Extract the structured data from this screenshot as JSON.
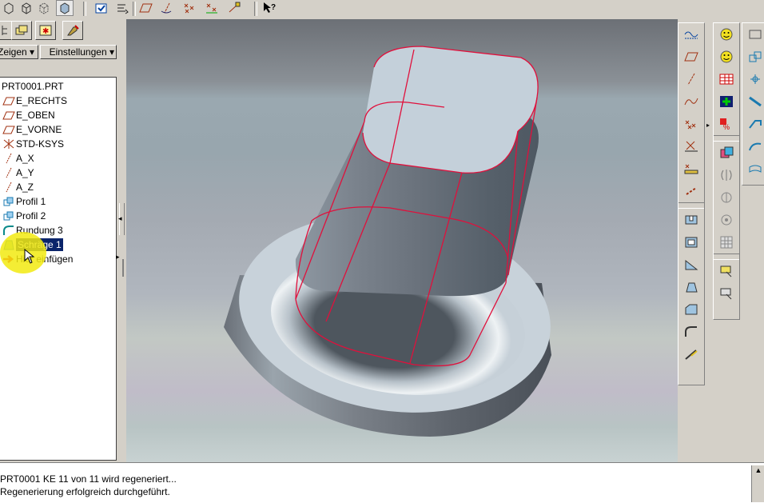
{
  "toolbar": {
    "icons": [
      "box-icon",
      "box-wire-icon",
      "box-hidden-icon",
      "box-shaded-icon",
      "saved-view-icon",
      "regenerate-icon",
      "datum-plane-icon",
      "datum-axis-icon",
      "datum-point-icon",
      "csys-icon",
      "sketch-icon",
      "whats-this-icon"
    ]
  },
  "tree_panel": {
    "tabs": [
      "model-tree-tab-icon",
      "layer-tab-icon",
      "star-tab-icon",
      "tools-tab-icon"
    ],
    "show_menu": "Zeigen",
    "settings_menu": "Einstellungen",
    "root": "PRT0001.PRT",
    "items": [
      {
        "label": "E_RECHTS",
        "icon": "datum-plane-icon"
      },
      {
        "label": "E_OBEN",
        "icon": "datum-plane-icon"
      },
      {
        "label": "E_VORNE",
        "icon": "datum-plane-icon"
      },
      {
        "label": "STD-KSYS",
        "icon": "csys-icon"
      },
      {
        "label": "A_X",
        "icon": "datum-axis-icon"
      },
      {
        "label": "A_Y",
        "icon": "datum-axis-icon"
      },
      {
        "label": "A_Z",
        "icon": "datum-axis-icon"
      },
      {
        "label": "Profil 1",
        "icon": "extrude-icon"
      },
      {
        "label": "Profil 2",
        "icon": "extrude-icon"
      },
      {
        "label": "Rundung 3",
        "icon": "round-icon"
      },
      {
        "label": "Schräge 1",
        "icon": "draft-icon",
        "selected": true
      },
      {
        "label": "Hier einfügen",
        "icon": "insert-arrow-icon"
      }
    ]
  },
  "status": {
    "lines": [
      "PRT0001 KE 11 von 11 wird regeneriert...",
      "Regenerierung erfolgreich durchgeführt."
    ]
  },
  "colors": {
    "edge_highlight": "#e0103c",
    "selection": "#0a246a",
    "pointer_highlight": "#f2ea10"
  }
}
